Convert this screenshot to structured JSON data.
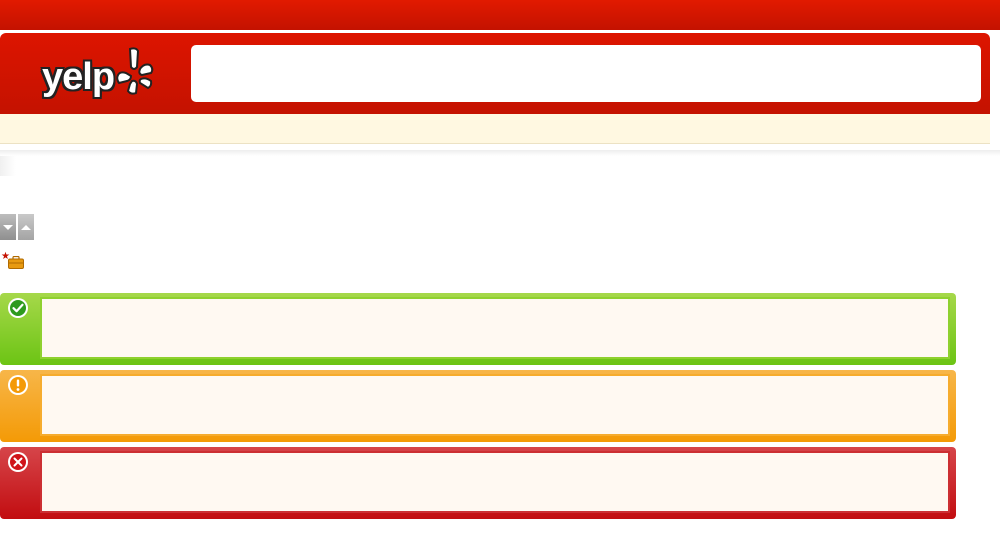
{
  "header": {
    "logo_text": "yelp",
    "search": {
      "value": "",
      "placeholder": ""
    }
  },
  "subbar": {
    "text": ""
  },
  "sort": {
    "down_icon": "caret-down-icon",
    "up_icon": "caret-up-icon"
  },
  "badges": {
    "star_icon": "star-icon",
    "briefcase_icon": "briefcase-icon"
  },
  "alerts": [
    {
      "type": "success",
      "icon": "check-circle-icon",
      "message": ""
    },
    {
      "type": "warning",
      "icon": "exclamation-circle-icon",
      "message": ""
    },
    {
      "type": "error",
      "icon": "x-circle-icon",
      "message": ""
    }
  ],
  "colors": {
    "brand_red": "#c41200",
    "success_green": "#6cc414",
    "warning_orange": "#f49a06",
    "error_red": "#c20d10",
    "message_bg": "#fff9f2"
  }
}
